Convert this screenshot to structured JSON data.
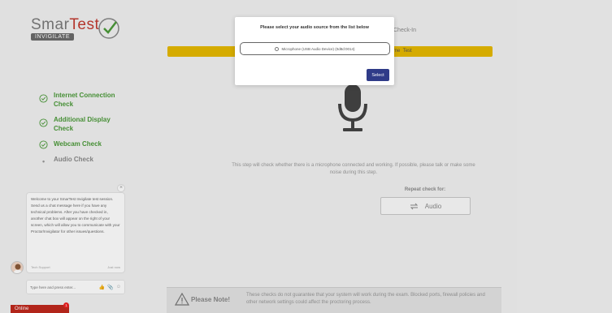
{
  "logo": {
    "name_part1": "Smar",
    "name_part2": "Test",
    "sub": "INVIGILATE"
  },
  "header": {
    "title": "Check-In",
    "banner_text": "me",
    "banner_text2": "Test"
  },
  "steps": [
    {
      "label": "Internet Connection Check",
      "status": "done"
    },
    {
      "label": "Additional Display Check",
      "status": "done"
    },
    {
      "label": "Webcam Check",
      "status": "done"
    },
    {
      "label": "Audio Check",
      "status": "pending"
    }
  ],
  "main": {
    "description": "This step will check whether there is a microphone connected and working. If possible, please talk or make some noise during this step.",
    "repeat_label": "Repeat check for:",
    "audio_button_label": "Audio"
  },
  "note": {
    "title": "Please Note!",
    "text": "These checks do not guarantee that your system will work during the exam. Blocked ports, firewall policies and other network settings could affect the proctoring process."
  },
  "chat": {
    "message": "Welcome to your SmarTest Invigilate test session. Send us a chat message here if you have any technical problems. After you have checked in, another chat box will appear on the right of your screen, which will allow you to communicate with your Proctor/Invigilator for other issues/questions.",
    "sender": "Tech Support",
    "time": "Just now",
    "input_placeholder": "Type here and press enter...",
    "online_label": "Online",
    "badge_count": "1"
  },
  "modal": {
    "title": "Please select your audio source from the list below",
    "option": "Microphone (USB Audio Device) (0d8d:0014)",
    "select_label": "Select"
  },
  "colors": {
    "green": "#4c9a3a",
    "yellow": "#e6b800",
    "button_blue": "#2f3b88",
    "online_red": "#c0281d"
  }
}
